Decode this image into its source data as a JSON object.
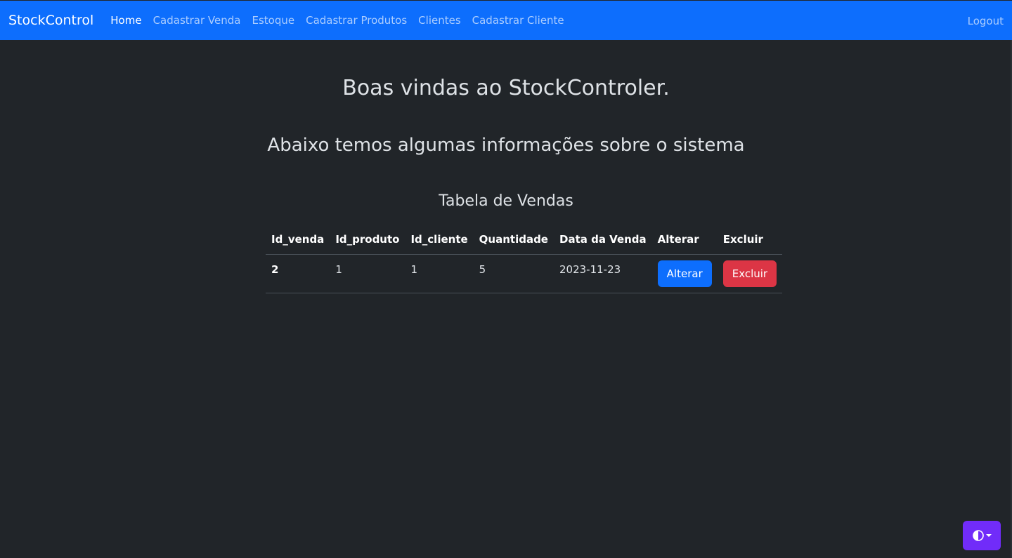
{
  "navbar": {
    "brand": "StockControl",
    "links": [
      {
        "label": "Home",
        "active": true
      },
      {
        "label": "Cadastrar Venda",
        "active": false
      },
      {
        "label": "Estoque",
        "active": false
      },
      {
        "label": "Cadastrar Produtos",
        "active": false
      },
      {
        "label": "Clientes",
        "active": false
      },
      {
        "label": "Cadastrar Cliente",
        "active": false
      }
    ],
    "logout": "Logout",
    "background_color": "#0d6efd"
  },
  "main": {
    "welcome": "Boas vindas ao StockControler.",
    "subtitle": "Abaixo temos algumas informações sobre o sistema",
    "table_title": "Tabela de Vendas"
  },
  "sales_table": {
    "headers": [
      "Id_venda",
      "Id_produto",
      "Id_cliente",
      "Quantidade",
      "Data da Venda",
      "Alterar",
      "Excluir"
    ],
    "rows": [
      {
        "id_venda": "2",
        "id_produto": "1",
        "id_cliente": "1",
        "quantidade": "5",
        "data_venda": "2023-11-23",
        "alterar_label": "Alterar",
        "excluir_label": "Excluir"
      }
    ]
  },
  "theme_toggle": {
    "icon": "contrast-half-circle-icon",
    "color": "#712cf9"
  },
  "colors": {
    "page_background": "#212529",
    "primary": "#0d6efd",
    "danger": "#dc3545"
  }
}
